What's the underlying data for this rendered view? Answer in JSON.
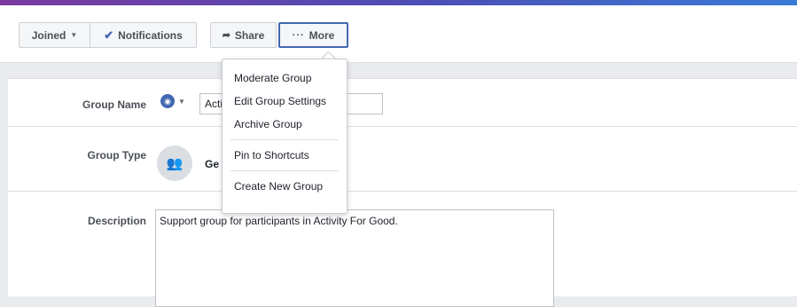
{
  "toolbar": {
    "joined_label": "Joined",
    "notifications_label": "Notifications",
    "share_label": "Share",
    "more_label": "More"
  },
  "more_menu": {
    "items": [
      {
        "label": "Moderate Group"
      },
      {
        "label": "Edit Group Settings"
      },
      {
        "label": "Archive Group"
      },
      {
        "label": "Pin to Shortcuts"
      },
      {
        "label": "Create New Group"
      }
    ]
  },
  "form": {
    "group_name": {
      "label": "Group Name",
      "value": "Acti"
    },
    "group_type": {
      "label": "Group Type",
      "value": "Ge"
    },
    "description": {
      "label": "Description",
      "value": "Support group for participants in Activity For Good."
    }
  },
  "icons": {
    "privacy": "globe-icon",
    "group_type": "people-icon",
    "share": "share-arrow-icon",
    "more": "ellipsis-icon",
    "notifications": "checkmark-icon"
  },
  "colors": {
    "accent": "#4267b2",
    "gradient_start": "#7b3aa0",
    "gradient_end": "#3a7bd5"
  }
}
